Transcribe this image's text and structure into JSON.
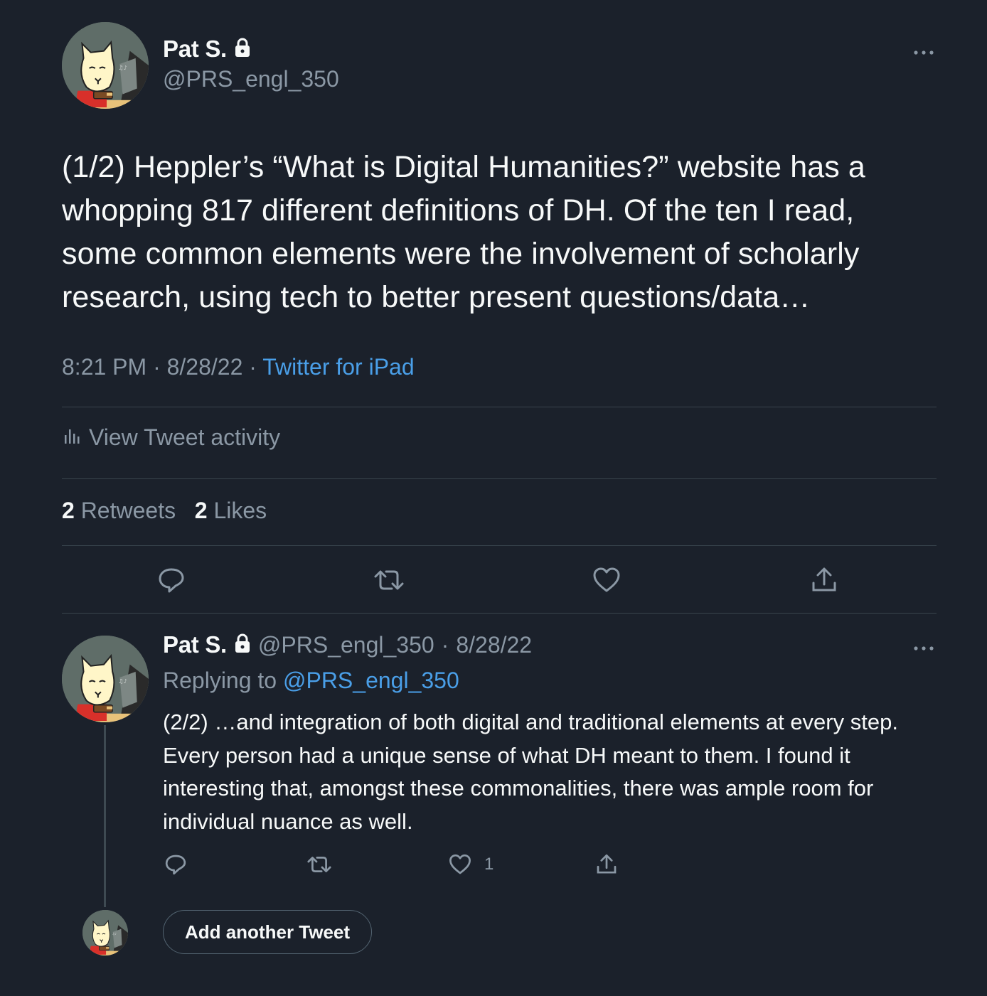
{
  "main_tweet": {
    "author_name": "Pat S.",
    "handle": "@PRS_engl_350",
    "text": "(1/2) Heppler’s “What is Digital Humanities?” website has a whopping 817 different definitions of DH. Of the ten I read, some common elements were the involvement of scholarly research, using tech to better present questions/data…",
    "time": "8:21 PM",
    "date": "8/28/22",
    "separator": "·",
    "source": "Twitter for iPad",
    "activity_label": "View Tweet activity",
    "retweets_count": "2",
    "retweets_label": "Retweets",
    "likes_count": "2",
    "likes_label": "Likes"
  },
  "reply_tweet": {
    "author_name": "Pat S.",
    "handle": "@PRS_engl_350",
    "separator": "·",
    "date": "8/28/22",
    "replying_prefix": "Replying to",
    "replying_handle": "@PRS_engl_350",
    "text": "(2/2) …and integration of both digital and traditional elements at every step. Every person had a unique sense of what DH meant to them. I found it interesting that, amongst these commonalities, there was ample room for individual nuance as well.",
    "like_count": "1"
  },
  "compose": {
    "add_button_label": "Add another Tweet"
  },
  "icons": {
    "lock": "lock-icon",
    "more": "more-icon",
    "reply": "reply-icon",
    "retweet": "retweet-icon",
    "like": "heart-icon",
    "share": "share-icon",
    "activity": "bar-chart-icon"
  },
  "colors": {
    "background": "#1b212b",
    "text": "#f7f9f9",
    "muted": "#8b98a5",
    "link": "#4a9fe8",
    "divider": "#38444d"
  }
}
